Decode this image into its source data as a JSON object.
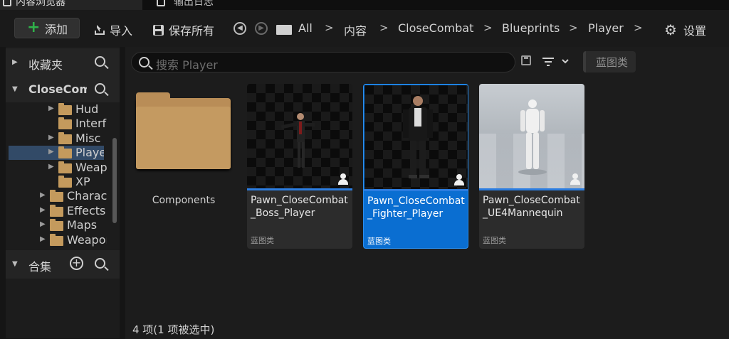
{
  "tabs": [
    {
      "label": "内容浏览器"
    },
    {
      "label": "输出日志"
    }
  ],
  "toolbar": {
    "add_label": "添加",
    "import_label": "导入",
    "save_all_label": "保存所有",
    "settings_label": "设置"
  },
  "breadcrumbs": [
    "All",
    "内容",
    "CloseCombat",
    "Blueprints",
    "Player"
  ],
  "sidebar": {
    "favorites_label": "收藏夹",
    "project_label": "CloseCombat",
    "tree": [
      {
        "label": "Hud",
        "level": 2,
        "expand": true
      },
      {
        "label": "Interface",
        "level": 2,
        "expand": false
      },
      {
        "label": "Misc",
        "level": 2,
        "expand": true
      },
      {
        "label": "Player",
        "level": 2,
        "expand": true,
        "selected": true
      },
      {
        "label": "Weapons",
        "level": 2,
        "expand": true
      },
      {
        "label": "XP",
        "level": 2,
        "expand": false
      },
      {
        "label": "Characters",
        "level": 1,
        "expand": true
      },
      {
        "label": "Effects",
        "level": 1,
        "expand": true
      },
      {
        "label": "Maps",
        "level": 1,
        "expand": true
      },
      {
        "label": "Weapons",
        "level": 1,
        "expand": true
      }
    ],
    "collections_label": "合集"
  },
  "main": {
    "search_placeholder": "搜索 Player",
    "filter_label": "蓝图类",
    "folder": {
      "name": "Components"
    },
    "assets": [
      {
        "name": "Pawn_CloseCombat\n_Boss_Player",
        "type": "蓝图类",
        "selected": false,
        "thumb": "checker"
      },
      {
        "name": "Pawn_CloseCombat\n_Fighter_Player",
        "type": "蓝图类",
        "selected": true,
        "thumb": "checker"
      },
      {
        "name": "Pawn_CloseCombat\n_UE4Mannequin",
        "type": "蓝图类",
        "selected": false,
        "thumb": "light"
      }
    ],
    "status": "4 项(1 项被选中)"
  },
  "colors": {
    "accent": "#0a6ed1",
    "folder": "#c49a5d",
    "add": "#2fb14a"
  }
}
